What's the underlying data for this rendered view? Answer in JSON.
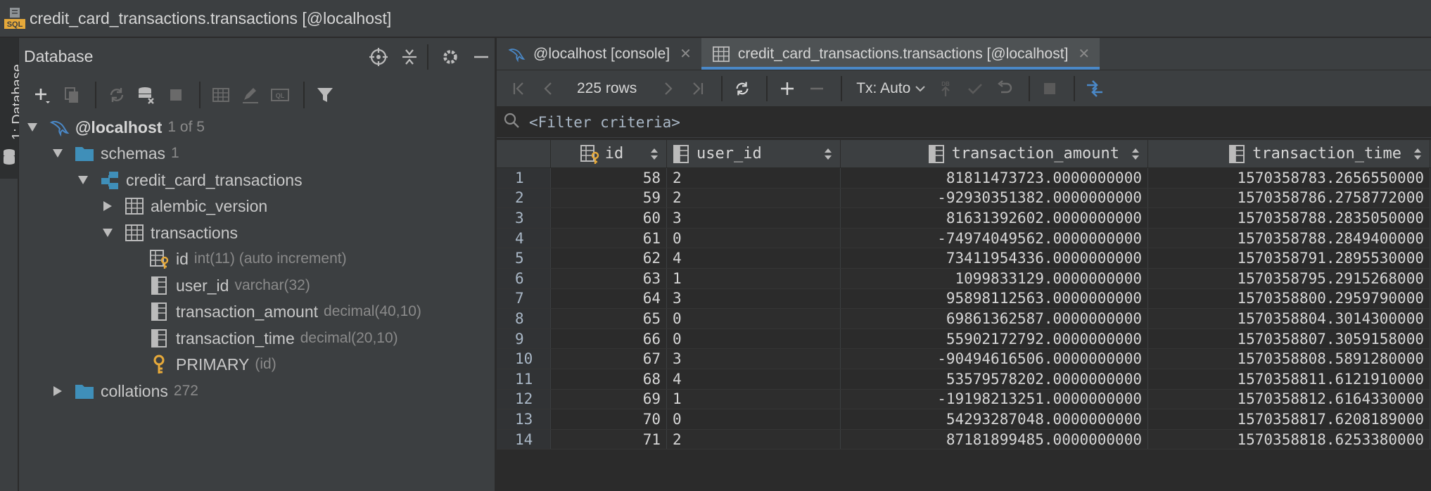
{
  "window": {
    "title": "credit_card_transactions.transactions [@localhost]",
    "icon": "sql-file-icon"
  },
  "toolstrip": {
    "tab_label": "1: Database"
  },
  "db_panel": {
    "title": "Database",
    "header_icons": [
      "crosshair-icon",
      "collapse-all-icon",
      "gear-icon",
      "minimize-icon"
    ],
    "toolbar_icons": [
      "add-icon",
      "copy-icon",
      "refresh-icon",
      "data-source-properties-icon",
      "stop-icon",
      "table-editor-icon",
      "edit-icon",
      "console-icon",
      "filter-icon"
    ],
    "tree": {
      "host": {
        "label": "@localhost",
        "count": "1 of 5"
      },
      "schemas": {
        "label": "schemas",
        "count": "1"
      },
      "schema": {
        "label": "credit_card_transactions"
      },
      "table_alembic": {
        "label": "alembic_version"
      },
      "table_transactions": {
        "label": "transactions"
      },
      "columns": [
        {
          "name": "id",
          "type": "int(11) (auto increment)"
        },
        {
          "name": "user_id",
          "type": "varchar(32)"
        },
        {
          "name": "transaction_amount",
          "type": "decimal(40,10)"
        },
        {
          "name": "transaction_time",
          "type": "decimal(20,10)"
        }
      ],
      "key": {
        "name": "PRIMARY",
        "cols": "(id)"
      },
      "collations": {
        "label": "collations",
        "count": "272"
      }
    }
  },
  "editor": {
    "tabs": [
      {
        "label": "@localhost [console]",
        "icon": "console-icon",
        "active": false
      },
      {
        "label": "credit_card_transactions.transactions [@localhost]",
        "icon": "table-icon",
        "active": true
      }
    ],
    "toolbar": {
      "rows": "225 rows",
      "tx": "Tx: Auto"
    },
    "filter_placeholder": "<Filter criteria>",
    "columns": [
      "id",
      "user_id",
      "transaction_amount",
      "transaction_time"
    ],
    "rows": [
      {
        "n": "1",
        "id": "58",
        "user_id": "2",
        "amount": "81811473723.0000000000",
        "time": "1570358783.2656550000"
      },
      {
        "n": "2",
        "id": "59",
        "user_id": "2",
        "amount": "-92930351382.0000000000",
        "time": "1570358786.2758772000"
      },
      {
        "n": "3",
        "id": "60",
        "user_id": "3",
        "amount": "81631392602.0000000000",
        "time": "1570358788.2835050000"
      },
      {
        "n": "4",
        "id": "61",
        "user_id": "0",
        "amount": "-74974049562.0000000000",
        "time": "1570358788.2849400000"
      },
      {
        "n": "5",
        "id": "62",
        "user_id": "4",
        "amount": "73411954336.0000000000",
        "time": "1570358791.2895530000"
      },
      {
        "n": "6",
        "id": "63",
        "user_id": "1",
        "amount": "1099833129.0000000000",
        "time": "1570358795.2915268000"
      },
      {
        "n": "7",
        "id": "64",
        "user_id": "3",
        "amount": "95898112563.0000000000",
        "time": "1570358800.2959790000"
      },
      {
        "n": "8",
        "id": "65",
        "user_id": "0",
        "amount": "69861362587.0000000000",
        "time": "1570358804.3014300000"
      },
      {
        "n": "9",
        "id": "66",
        "user_id": "0",
        "amount": "55902172792.0000000000",
        "time": "1570358807.3059158000"
      },
      {
        "n": "10",
        "id": "67",
        "user_id": "3",
        "amount": "-90494616506.0000000000",
        "time": "1570358808.5891280000"
      },
      {
        "n": "11",
        "id": "68",
        "user_id": "4",
        "amount": "53579578202.0000000000",
        "time": "1570358811.6121910000"
      },
      {
        "n": "12",
        "id": "69",
        "user_id": "1",
        "amount": "-19198213251.0000000000",
        "time": "1570358812.6164330000"
      },
      {
        "n": "13",
        "id": "70",
        "user_id": "0",
        "amount": "54293287048.0000000000",
        "time": "1570358817.6208189000"
      },
      {
        "n": "14",
        "id": "71",
        "user_id": "2",
        "amount": "87181899485.0000000000",
        "time": "1570358818.6253380000"
      }
    ]
  },
  "colors": {
    "accent": "#4a88c7",
    "folder": "#3f8fb9",
    "key": "#e6a93a"
  }
}
